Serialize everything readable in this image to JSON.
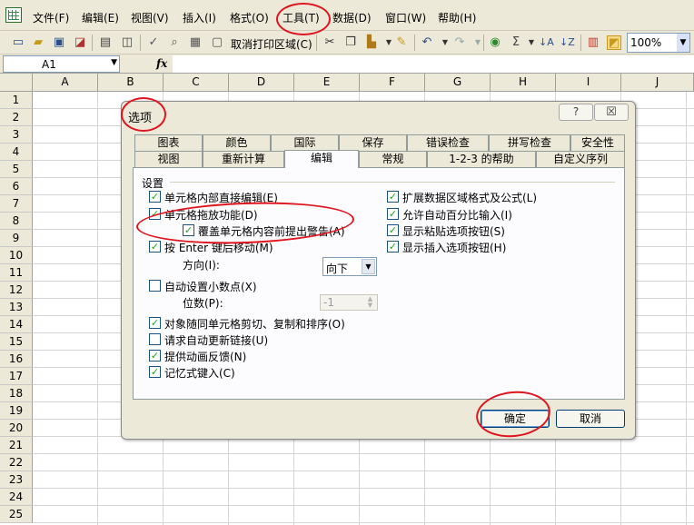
{
  "menubar": {
    "items": [
      "文件(F)",
      "编辑(E)",
      "视图(V)",
      "插入(I)",
      "格式(O)",
      "工具(T)",
      "数据(D)",
      "窗口(W)",
      "帮助(H)"
    ]
  },
  "toolbar": {
    "clear_print_area_label": "取消打印区域(C)",
    "zoom_value": "100%"
  },
  "formula_bar": {
    "cell_reference": "A1",
    "fx_label": "fx",
    "formula_value": ""
  },
  "sheet": {
    "columns": [
      "A",
      "B",
      "C",
      "D",
      "E",
      "F",
      "G",
      "H",
      "I",
      "J"
    ],
    "rows": [
      "1",
      "2",
      "3",
      "4",
      "5",
      "6",
      "7",
      "8",
      "9",
      "10",
      "11",
      "12",
      "13",
      "14",
      "15",
      "16",
      "17",
      "18",
      "19",
      "20",
      "21",
      "22",
      "23",
      "24",
      "25"
    ]
  },
  "dialog": {
    "title": "选项",
    "help_button": "?",
    "close_button": "☒",
    "tabs_row1": [
      "图表",
      "颜色",
      "国际",
      "保存",
      "错误检查",
      "拼写检查",
      "安全性"
    ],
    "tabs_row2": [
      "视图",
      "重新计算",
      "编辑",
      "常规",
      "1-2-3 的帮助",
      "自定义序列"
    ],
    "active_tab": "编辑",
    "group_label": "设置",
    "options_left": [
      {
        "label": "单元格内部直接编辑(E)",
        "checked": true
      },
      {
        "label": "单元格拖放功能(D)",
        "checked": true
      },
      {
        "label": "覆盖单元格内容前提出警告(A)",
        "checked": true
      },
      {
        "label": "按 Enter 键后移动(M)",
        "checked": true
      },
      {
        "label": "自动设置小数点(X)",
        "checked": false
      },
      {
        "label": "对象随同单元格剪切、复制和排序(O)",
        "checked": true
      },
      {
        "label": "请求自动更新链接(U)",
        "checked": false
      },
      {
        "label": "提供动画反馈(N)",
        "checked": true
      },
      {
        "label": "记忆式键入(C)",
        "checked": true
      }
    ],
    "options_right": [
      {
        "label": "扩展数据区域格式及公式(L)",
        "checked": true
      },
      {
        "label": "允许自动百分比输入(I)",
        "checked": true
      },
      {
        "label": "显示粘贴选项按钮(S)",
        "checked": true
      },
      {
        "label": "显示插入选项按钮(H)",
        "checked": true
      }
    ],
    "direction_label": "方向(I):",
    "direction_value": "向下",
    "places_label": "位数(P):",
    "places_value": "-1",
    "ok_label": "确定",
    "cancel_label": "取消"
  },
  "colors": {
    "annotation": "#e0141e",
    "checkmark": "#21a121",
    "chrome": "#ece9d8"
  }
}
